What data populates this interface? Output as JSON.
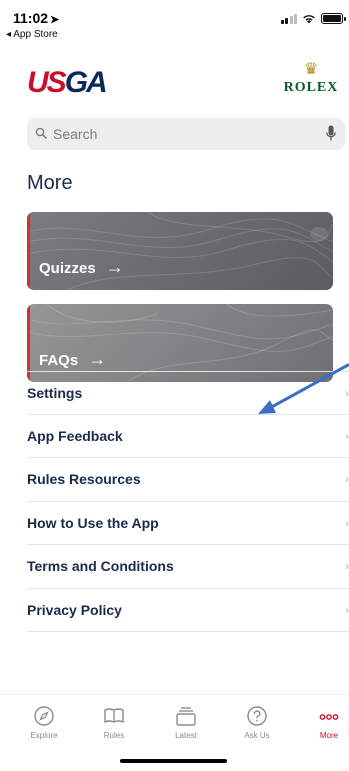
{
  "status_bar": {
    "time": "11:02",
    "back_label": "App Store"
  },
  "brand": {
    "logo_left_a": "US",
    "logo_left_b": "GA",
    "sponsor": "ROLEX"
  },
  "search": {
    "placeholder": "Search"
  },
  "page": {
    "title": "More"
  },
  "cards": [
    {
      "label": "Quizzes",
      "arrow": "→"
    },
    {
      "label": "FAQs",
      "arrow": "→"
    }
  ],
  "menu": [
    {
      "label": "Settings"
    },
    {
      "label": "App Feedback"
    },
    {
      "label": "Rules Resources"
    },
    {
      "label": "How to Use the App"
    },
    {
      "label": "Terms and Conditions"
    },
    {
      "label": "Privacy Policy"
    }
  ],
  "tabs": [
    {
      "label": "Explore",
      "icon": "compass-icon"
    },
    {
      "label": "Rules",
      "icon": "book-icon"
    },
    {
      "label": "Latest",
      "icon": "stack-icon"
    },
    {
      "label": "Ask Us",
      "icon": "question-icon"
    },
    {
      "label": "More",
      "icon": "more-dots-icon",
      "active": true
    }
  ],
  "colors": {
    "accent_red": "#c8102e",
    "navy": "#1a2b4c",
    "annotation_arrow": "#3b6fc4"
  }
}
